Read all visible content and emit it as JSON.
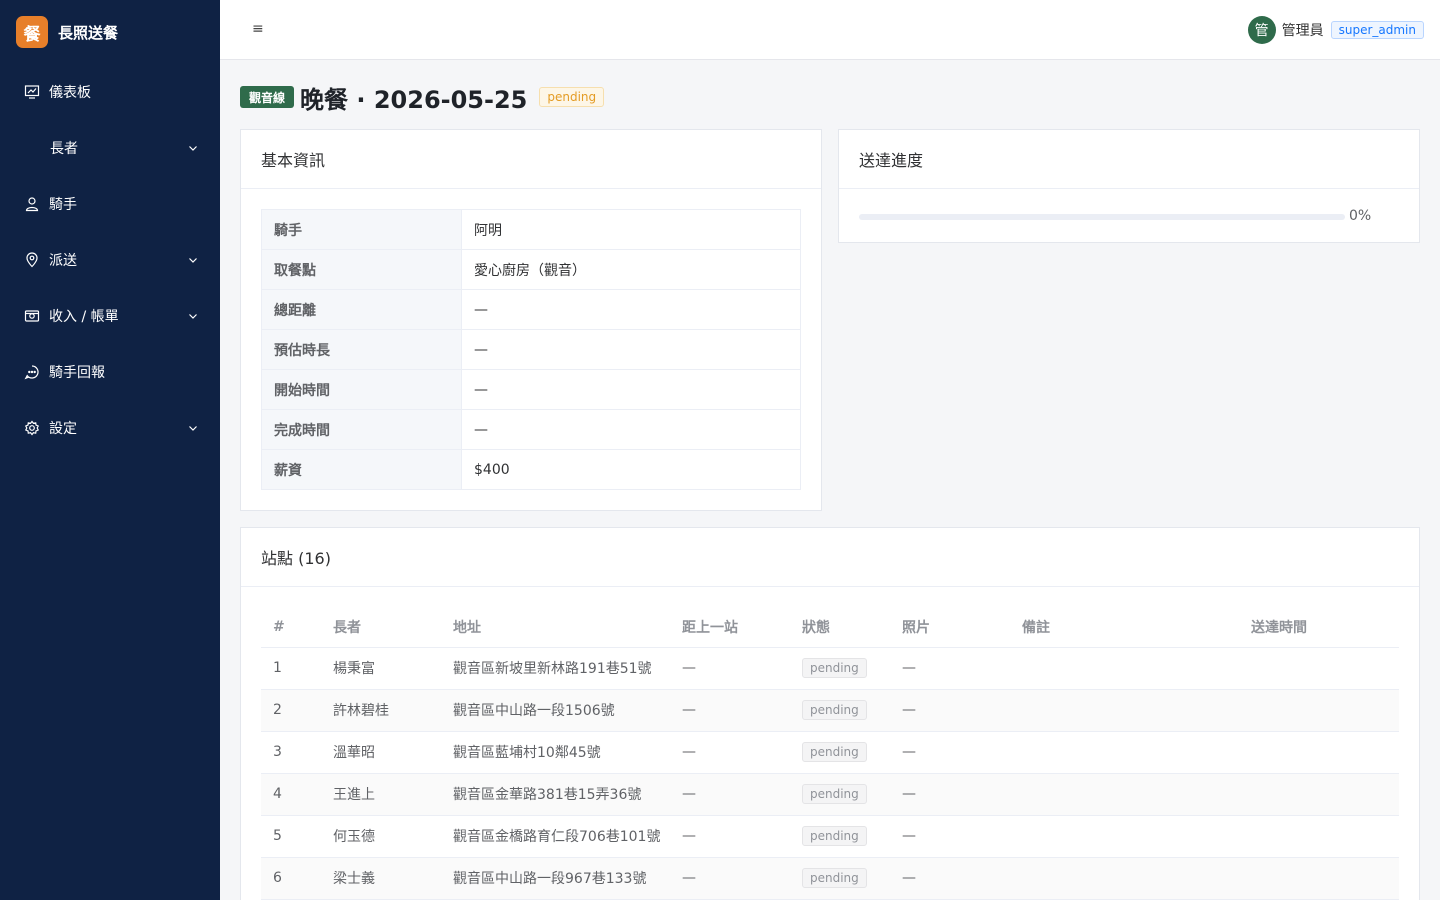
{
  "brand": {
    "logo_char": "餐",
    "title": "長照送餐"
  },
  "sidebar": {
    "items": [
      {
        "label": "儀表板",
        "icon": "dashboard-icon",
        "has_children": false
      },
      {
        "label": "長者",
        "icon": "",
        "has_children": true
      },
      {
        "label": "騎手",
        "icon": "user-icon",
        "has_children": false
      },
      {
        "label": "派送",
        "icon": "location-icon",
        "has_children": true
      },
      {
        "label": "收入 / 帳單",
        "icon": "money-icon",
        "has_children": true
      },
      {
        "label": "騎手回報",
        "icon": "chat-icon",
        "has_children": false
      },
      {
        "label": "設定",
        "icon": "gear-icon",
        "has_children": true
      }
    ]
  },
  "topbar": {
    "menu_icon": "≡",
    "avatar_char": "管",
    "user_name": "管理員",
    "role": "super_admin"
  },
  "header": {
    "route_tag": "觀音線",
    "title": "晚餐 · 2026-05-25",
    "status": "pending"
  },
  "info": {
    "title": "基本資訊",
    "rows": [
      {
        "key": "騎手",
        "value": "阿明"
      },
      {
        "key": "取餐點",
        "value": "愛心廚房（觀音）"
      },
      {
        "key": "總距離",
        "value": "—"
      },
      {
        "key": "預估時長",
        "value": "—"
      },
      {
        "key": "開始時間",
        "value": "—"
      },
      {
        "key": "完成時間",
        "value": "—"
      },
      {
        "key": "薪資",
        "value": "$400"
      }
    ]
  },
  "progress": {
    "title": "送達進度",
    "percent": 0,
    "label": "0%"
  },
  "stops": {
    "title": "站點 (16)",
    "columns": [
      "#",
      "長者",
      "地址",
      "距上一站",
      "狀態",
      "照片",
      "備註",
      "送達時間"
    ],
    "rows": [
      {
        "no": "1",
        "name": "楊秉富",
        "address": "觀音區新坡里新林路191巷51號",
        "distance": "—",
        "status": "pending",
        "photo": "—",
        "note": "",
        "time": ""
      },
      {
        "no": "2",
        "name": "許林碧桂",
        "address": "觀音區中山路一段1506號",
        "distance": "—",
        "status": "pending",
        "photo": "—",
        "note": "",
        "time": ""
      },
      {
        "no": "3",
        "name": "溫華昭",
        "address": "觀音區藍埔村10鄰45號",
        "distance": "—",
        "status": "pending",
        "photo": "—",
        "note": "",
        "time": ""
      },
      {
        "no": "4",
        "name": "王進上",
        "address": "觀音區金華路381巷15弄36號",
        "distance": "—",
        "status": "pending",
        "photo": "—",
        "note": "",
        "time": ""
      },
      {
        "no": "5",
        "name": "何玉德",
        "address": "觀音區金橋路育仁段706巷101號",
        "distance": "—",
        "status": "pending",
        "photo": "—",
        "note": "",
        "time": ""
      },
      {
        "no": "6",
        "name": "梁士義",
        "address": "觀音區中山路一段967巷133號",
        "distance": "—",
        "status": "pending",
        "photo": "—",
        "note": "",
        "time": ""
      }
    ]
  },
  "colors": {
    "sidebar_bg": "#0f2244",
    "brand_logo": "#e77f2a",
    "route_tag": "#2f6b4b",
    "role_tag": "#1677ff",
    "status_pending": "#e49c25"
  }
}
